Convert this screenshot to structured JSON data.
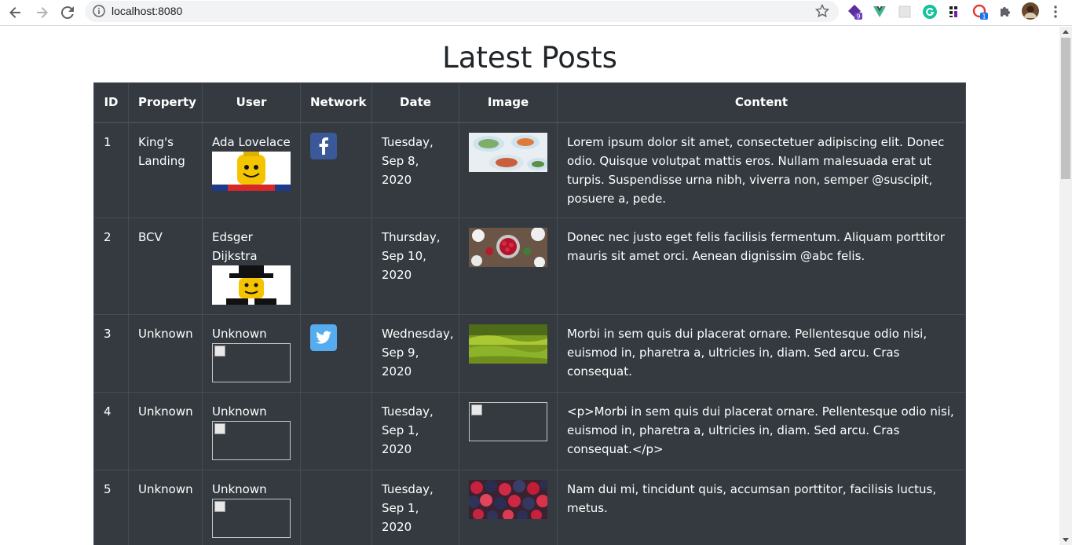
{
  "browser": {
    "url": "localhost:8080",
    "extensions": [
      "ext-purple-badge-icon",
      "vue-icon",
      "blank-ext-icon",
      "grammarly-icon",
      "ext-grid-icon",
      "ext-red-badge-icon",
      "puzzle-icon",
      "profile-avatar"
    ],
    "badge_1": "9",
    "badge_2": "1"
  },
  "page": {
    "title": "Latest Posts"
  },
  "table": {
    "headers": [
      "ID",
      "Property",
      "User",
      "Network",
      "Date",
      "Image",
      "Content"
    ],
    "rows": [
      {
        "id": "1",
        "property": "King's Landing",
        "user": "Ada Lovelace",
        "avatar": "lego-yellow",
        "network": "facebook",
        "date": "Tuesday, Sep 8, 2020",
        "image": "food-bowls",
        "content": "Lorem ipsum dolor sit amet, consectetuer adipiscing elit. Donec odio. Quisque volutpat mattis eros. Nullam malesuada erat ut turpis. Suspendisse urna nibh, viverra non, semper @suscipit, posuere a, pede."
      },
      {
        "id": "2",
        "property": "BCV",
        "user": "Edsger Dijkstra",
        "avatar": "lego-hat",
        "network": "",
        "date": "Thursday, Sep 10, 2020",
        "image": "berries-table",
        "content": "Donec nec justo eget felis facilisis fermentum. Aliquam porttitor mauris sit amet orci. Aenean dignissim @abc felis."
      },
      {
        "id": "3",
        "property": "Unknown",
        "user": "Unknown",
        "avatar": "broken",
        "network": "twitter",
        "date": "Wednesday, Sep 9, 2020",
        "image": "green-field",
        "content": "Morbi in sem quis dui placerat ornare. Pellentesque odio nisi, euismod in, pharetra a, ultricies in, diam. Sed arcu. Cras consequat."
      },
      {
        "id": "4",
        "property": "Unknown",
        "user": "Unknown",
        "avatar": "broken",
        "network": "",
        "date": "Tuesday, Sep 1, 2020",
        "image": "broken",
        "content": "<p>Morbi in sem quis dui placerat ornare. Pellentesque odio nisi, euismod in, pharetra a, ultricies in, diam. Sed arcu. Cras consequat.</p>"
      },
      {
        "id": "5",
        "property": "Unknown",
        "user": "Unknown",
        "avatar": "broken",
        "network": "",
        "date": "Tuesday, Sep 1, 2020",
        "image": "mixed-berries",
        "content": "Nam dui mi, tincidunt quis, accumsan porttitor, facilisis luctus, metus."
      }
    ]
  }
}
